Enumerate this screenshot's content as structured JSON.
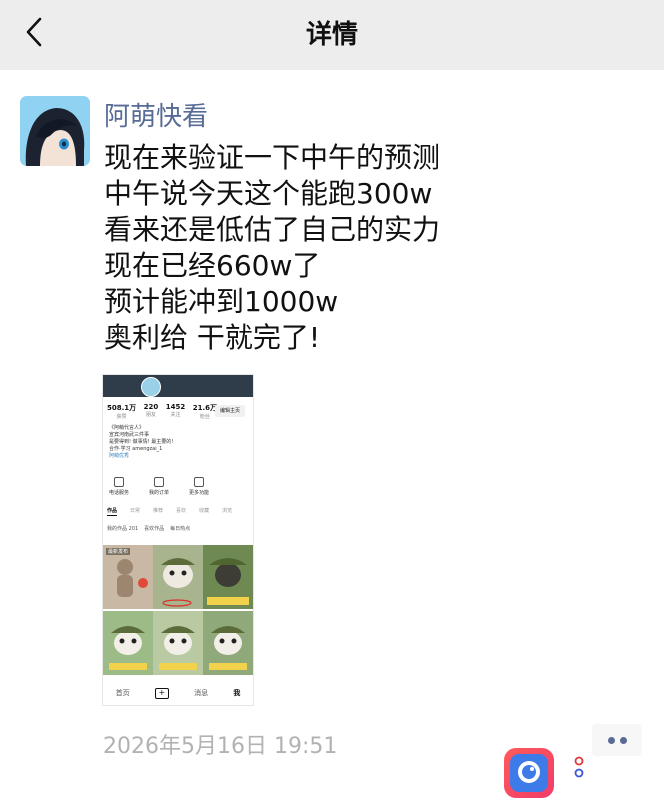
{
  "navbar": {
    "title": "详情"
  },
  "post": {
    "username": "阿萌快看",
    "lines": [
      "现在来验证一下中午的预测",
      "中午说今天这个能跑300w",
      "看来还是低估了自己的实力",
      "现在已经660w了",
      "预计能冲到1000w",
      "奥利给 干就完了!"
    ],
    "timestamp": "2026年5月16日 19:51"
  },
  "screenshot": {
    "stats": [
      {
        "num": "508.1万",
        "label": "获赞"
      },
      {
        "num": "220",
        "label": "朋友"
      },
      {
        "num": "1452",
        "label": "关注"
      },
      {
        "num": "21.6万",
        "label": "粉丝"
      }
    ],
    "edit_label": "编辑主页",
    "bio": [
      "《阿萌代言人》",
      "宣宾河南武三件事",
      "是要得到! 做事情! 最主要的!",
      "合作·学习 amengzai_1"
    ],
    "tag": "阿萌优秀",
    "quick": [
      "电话服务",
      "我的订单",
      "更多功能"
    ],
    "tabs": [
      "作品",
      "日常",
      "推荐",
      "喜欢",
      "收藏",
      "浏览"
    ],
    "filters": [
      "我的作品 201",
      "喜欢作品",
      "每日热点"
    ],
    "grid": [
      {
        "label": "最新发布",
        "views": "",
        "color": "#b8a48c"
      },
      {
        "label": "",
        "views": "",
        "color": "#a7b48e"
      },
      {
        "label": "",
        "views": "",
        "color": "#6e8a52"
      },
      {
        "label": "",
        "views": "",
        "color": "#9dbb86"
      },
      {
        "label": "",
        "views": "",
        "color": "#b9c9a2"
      },
      {
        "label": "",
        "views": "",
        "color": "#8fa97a"
      }
    ],
    "nav": [
      "首页",
      "",
      "消息",
      "我"
    ]
  },
  "colors": {
    "link": "#576b95",
    "navbar_bg": "#ededed",
    "timestamp": "#b2b2b2"
  }
}
